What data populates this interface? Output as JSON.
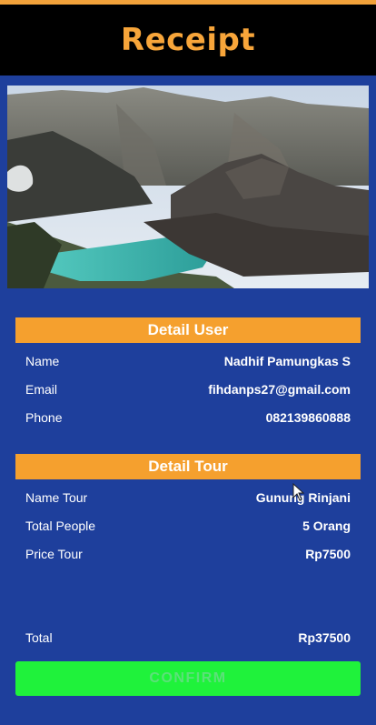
{
  "header": {
    "title": "Receipt"
  },
  "hero": {
    "image_subject": "volcanic crater lake landscape"
  },
  "detail_user": {
    "title": "Detail User",
    "rows": [
      {
        "label": "Name",
        "value": "Nadhif Pamungkas S"
      },
      {
        "label": "Email",
        "value": "fihdanps27@gmail.com"
      },
      {
        "label": "Phone",
        "value": "082139860888"
      }
    ]
  },
  "detail_tour": {
    "title": "Detail Tour",
    "rows": [
      {
        "label": "Name Tour",
        "value": "Gunung Rinjani"
      },
      {
        "label": "Total People",
        "value": "5 Orang"
      },
      {
        "label": "Price Tour",
        "value": "Rp7500"
      }
    ]
  },
  "total": {
    "label": "Total",
    "value": "Rp37500"
  },
  "confirm_label": "CONFIRM",
  "colors": {
    "header_bg": "#000000",
    "title": "#f7a53a",
    "panel_bg": "#1e3f9c",
    "section_bar": "#f5a02e",
    "confirm_bg": "#1ff23b"
  }
}
